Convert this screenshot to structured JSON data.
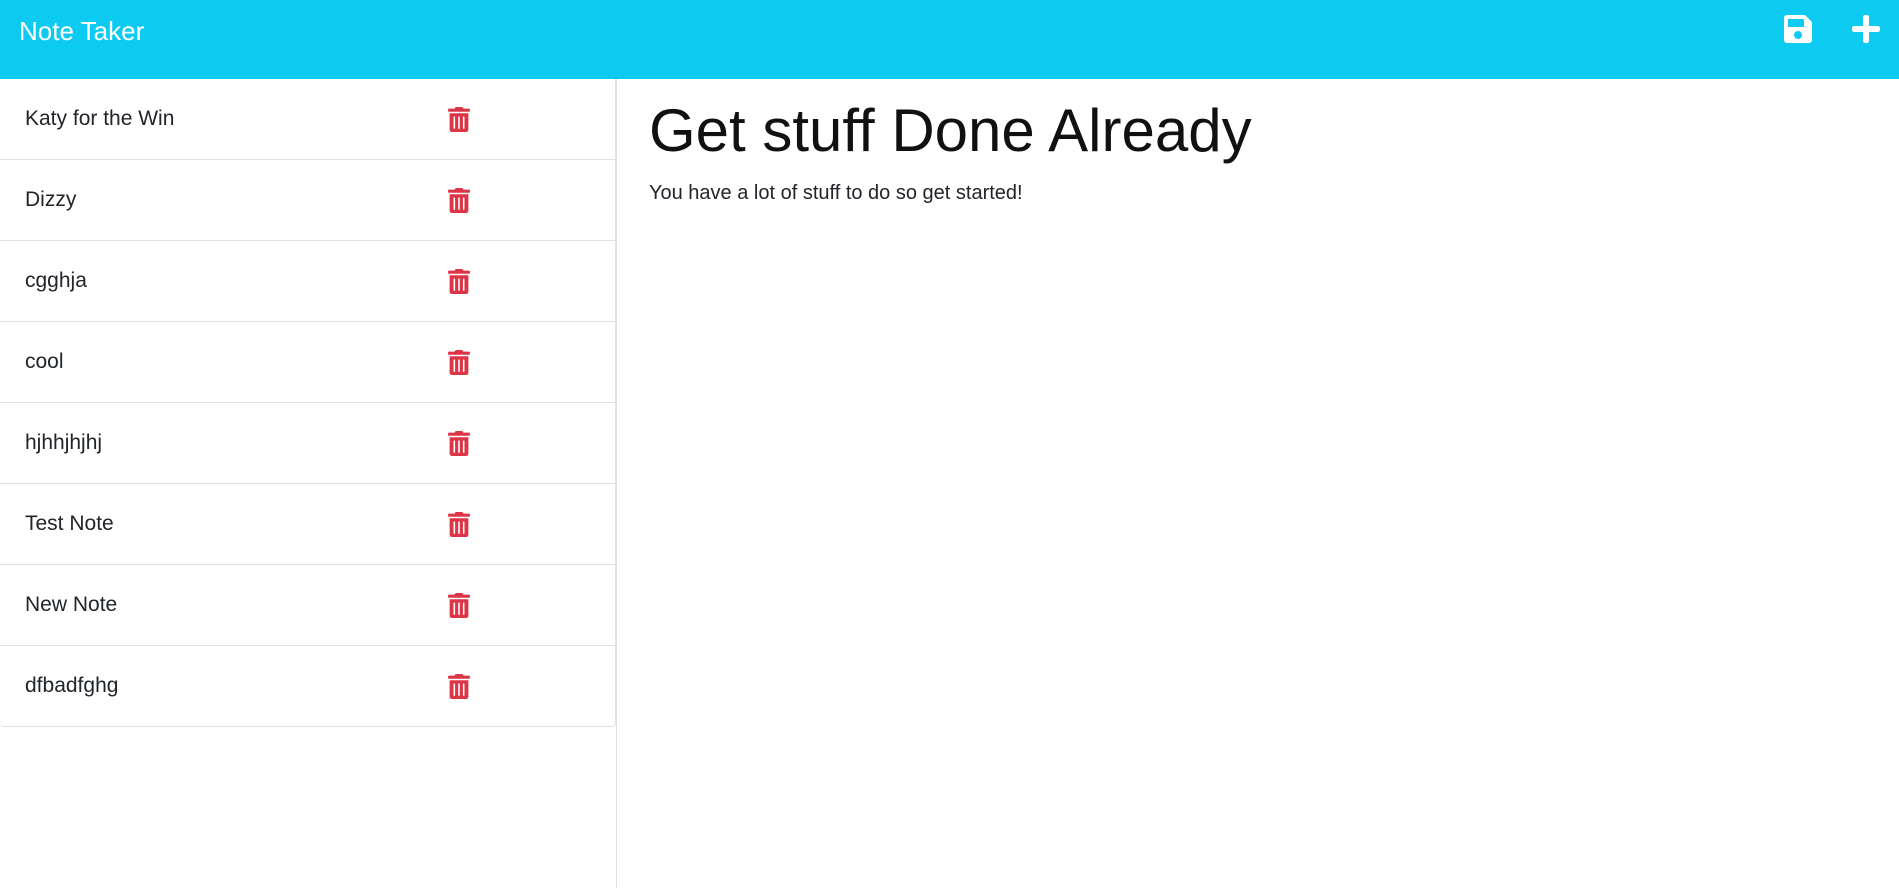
{
  "app": {
    "title": "Note Taker",
    "accent_color": "#0dcaf0",
    "delete_color": "#dc3545"
  },
  "toolbar": {
    "save_icon": "save-icon",
    "new_icon": "plus-icon"
  },
  "notes": [
    {
      "title": "Katy for the Win"
    },
    {
      "title": "Dizzy"
    },
    {
      "title": "cgghja"
    },
    {
      "title": "cool"
    },
    {
      "title": "hjhhjhjhj"
    },
    {
      "title": "Test Note"
    },
    {
      "title": "New Note"
    },
    {
      "title": "dfbadfghg"
    }
  ],
  "active_note": {
    "title": "Get stuff Done Already",
    "text": "You have a lot of stuff to do so get started!"
  }
}
